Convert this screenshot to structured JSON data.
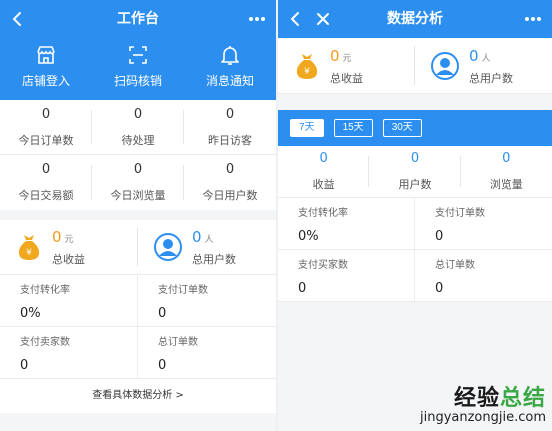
{
  "left": {
    "topbar": {
      "title": "工作台"
    },
    "quick_actions": [
      {
        "label": "店铺登入",
        "icon": "store-icon"
      },
      {
        "label": "扫码核销",
        "icon": "scan-icon"
      },
      {
        "label": "消息通知",
        "icon": "bell-icon"
      }
    ],
    "stats": [
      {
        "value": "0",
        "label": "今日订单数"
      },
      {
        "value": "0",
        "label": "待处理"
      },
      {
        "value": "0",
        "label": "昨日访客"
      },
      {
        "value": "0",
        "label": "今日交易额"
      },
      {
        "value": "0",
        "label": "今日浏览量"
      },
      {
        "value": "0",
        "label": "今日用户数"
      }
    ],
    "summary": {
      "income": {
        "value": "0",
        "unit": "元",
        "label": "总收益",
        "icon": "money-bag-icon"
      },
      "users": {
        "value": "0",
        "unit": "人",
        "label": "总用户数",
        "icon": "user-avatar-icon"
      }
    },
    "metrics": [
      {
        "label": "支付转化率",
        "value": "0%"
      },
      {
        "label": "支付订单数",
        "value": "0"
      },
      {
        "label": "支付卖家数",
        "value": "0"
      },
      {
        "label": "总订单数",
        "value": "0"
      }
    ],
    "more_link": "查看具体数据分析 >"
  },
  "right": {
    "topbar": {
      "title": "数据分析"
    },
    "summary": {
      "income": {
        "value": "0",
        "unit": "元",
        "label": "总收益",
        "icon": "money-bag-icon"
      },
      "users": {
        "value": "0",
        "unit": "人",
        "label": "总用户数",
        "icon": "user-avatar-icon"
      }
    },
    "periods": [
      "7天",
      "15天",
      "30天"
    ],
    "active_period": "7天",
    "stats": [
      {
        "value": "0",
        "label": "收益"
      },
      {
        "value": "0",
        "label": "用户数"
      },
      {
        "value": "0",
        "label": "浏览量"
      }
    ],
    "metrics": [
      {
        "label": "支付转化率",
        "value": "0%"
      },
      {
        "label": "支付订单数",
        "value": "0"
      },
      {
        "label": "支付买家数",
        "value": "0"
      },
      {
        "label": "总订单数",
        "value": "0"
      }
    ]
  },
  "watermark": {
    "logo_a": "经验",
    "logo_b": "总结",
    "url": "jingyanzongjie.com"
  },
  "colors": {
    "primary": "#2c8ff0",
    "accent_orange": "#f29b1c",
    "bg": "#f4f5f7"
  }
}
